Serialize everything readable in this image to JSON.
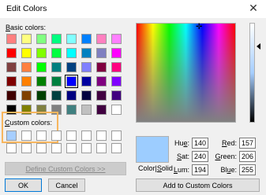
{
  "window": {
    "title": "Edit Colors",
    "close_glyph": "✕"
  },
  "basic": {
    "label_mnemonic": "B",
    "label_rest": "asic colors:",
    "colors": [
      "#ff8080",
      "#ffff80",
      "#80ff80",
      "#00ff80",
      "#80ffff",
      "#0080ff",
      "#ff80c0",
      "#ff80ff",
      "#ff0000",
      "#ffff00",
      "#80ff00",
      "#00ff40",
      "#00ffff",
      "#0080c0",
      "#8080c0",
      "#ff00ff",
      "#804040",
      "#ff8040",
      "#00ff00",
      "#008080",
      "#004080",
      "#8080ff",
      "#800040",
      "#ff0080",
      "#800000",
      "#ff8000",
      "#008000",
      "#008040",
      "#0000ff",
      "#0000a0",
      "#800080",
      "#8000ff",
      "#400000",
      "#804000",
      "#004000",
      "#004040",
      "#000080",
      "#000040",
      "#400040",
      "#400080",
      "#000000",
      "#808000",
      "#808040",
      "#808080",
      "#408080",
      "#c0c0c0",
      "#400040",
      "#ffffff"
    ],
    "selected_index": 28
  },
  "custom": {
    "label_mnemonic": "C",
    "label_rest": "ustom colors:",
    "colors": [
      "#a6ceff",
      "#ffffff",
      "#ffffff",
      "#ffffff",
      "#ffffff",
      "#ffffff",
      "#ffffff",
      "#ffffff",
      "#ffffff",
      "#ffffff",
      "#ffffff",
      "#ffffff",
      "#ffffff",
      "#ffffff",
      "#ffffff",
      "#ffffff"
    ]
  },
  "buttons": {
    "define": "Define Custom Colors >>",
    "ok": "OK",
    "cancel": "Cancel",
    "add": "Add to Custom Colors"
  },
  "preview": {
    "color": "#9dcdff",
    "label_pre": "Color|",
    "label_mnemonic": "S",
    "label_post": "olid"
  },
  "fields": {
    "hue": {
      "label_mnemonic": "e",
      "label_pre": "Hu",
      "label_post": ":",
      "value": "140"
    },
    "sat": {
      "label_mnemonic": "S",
      "label_pre": "",
      "label_post": "at:",
      "value": "240"
    },
    "lum": {
      "label_mnemonic": "L",
      "label_pre": "",
      "label_post": "um:",
      "value": "194"
    },
    "red": {
      "label_mnemonic": "R",
      "label_pre": "",
      "label_post": "ed:",
      "value": "157"
    },
    "green": {
      "label_mnemonic": "G",
      "label_pre": "",
      "label_post": "reen:",
      "value": "206"
    },
    "blue": {
      "label_mnemonic": "u",
      "label_pre": "Bl",
      "label_post": "e:",
      "value": "255"
    }
  },
  "icons": {
    "crosshair": "crosshair-icon",
    "lum_arrow": "triangle-left-icon"
  }
}
